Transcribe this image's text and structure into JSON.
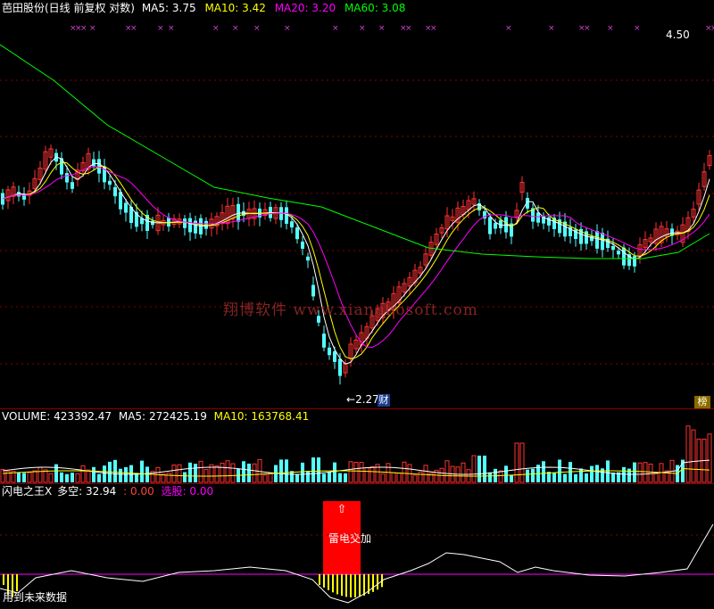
{
  "header": {
    "stock_name": "芭田股份(日线 前复权 对数)",
    "ma5_label": "MA5:",
    "ma5_value": "3.75",
    "ma10_label": "MA10:",
    "ma10_value": "3.42",
    "ma20_label": "MA20:",
    "ma20_value": "3.20",
    "ma60_label": "MA60:",
    "ma60_value": "3.08"
  },
  "price_panel": {
    "high_label": "4.50",
    "low_label": "2.27",
    "cai_tag": "财",
    "bang_tag": "榜",
    "watermark": "翔博软件  www.xiangbosoft.com"
  },
  "volume_panel": {
    "vol_label": "VOLUME:",
    "vol_value": "423392.47",
    "ma5_label": "MA5:",
    "ma5_value": "272425.19",
    "ma10_label": "MA10:",
    "ma10_value": "163768.41"
  },
  "indicator_panel": {
    "name": "闪电之王X",
    "duokong_label": "多空:",
    "duokong_value": "32.94",
    "sep_label": ":",
    "sep_value": "0.00",
    "xuangu_label": "选股:",
    "xuangu_value": "0.00",
    "signal_text": "雷电交加",
    "arrow_glyph": "⇧",
    "footer_text": "用到未来数据"
  },
  "colors": {
    "ma5": "#ffffff",
    "ma10": "#ffff00",
    "ma20": "#ff00ff",
    "ma60": "#00ff00",
    "up": "#ff3232",
    "down": "#54ffff",
    "grid": "#8b0000",
    "signal": "#ff0000"
  }
}
